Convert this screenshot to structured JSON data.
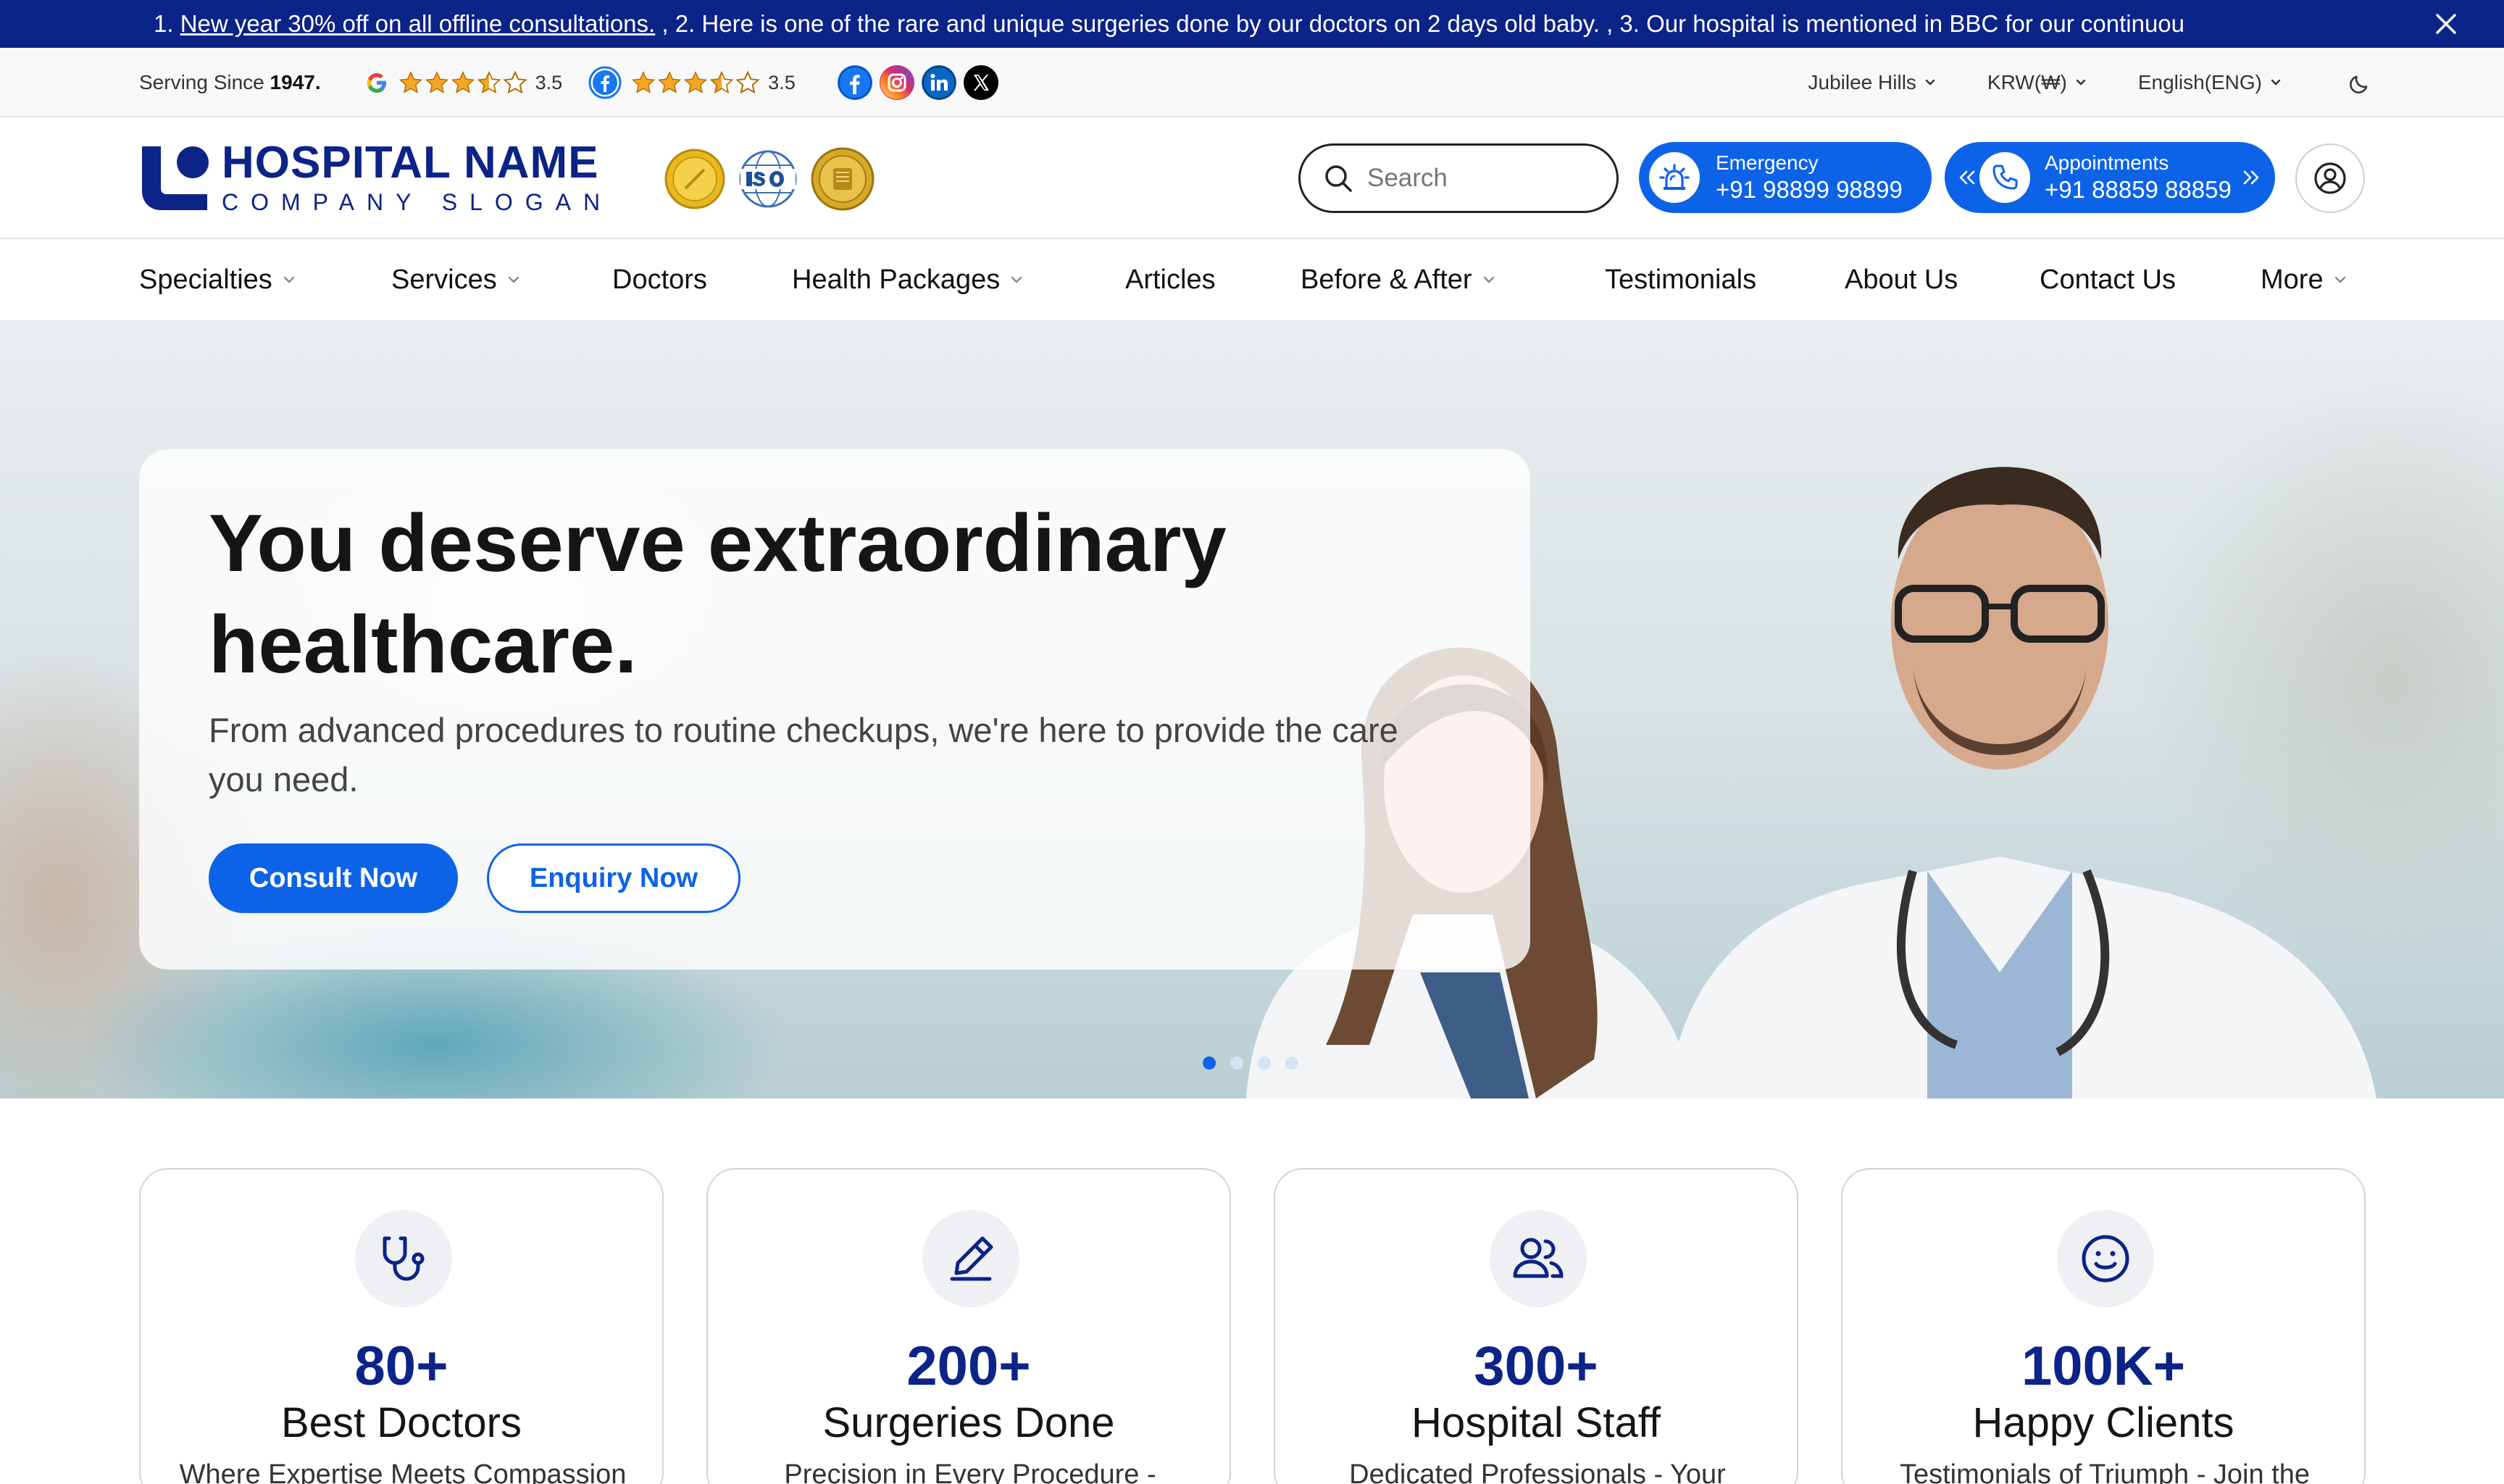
{
  "announcement": {
    "prefix": "1. ",
    "link_text": "New year 30% off on all offline consultations.",
    "rest": " , 2. Here is one of the rare and unique surgeries done by our doctors on 2 days old baby. , 3. Our hospital is mentioned in BBC for our continuou"
  },
  "utility": {
    "serving_label": "Serving Since ",
    "serving_year": "1947.",
    "google_rating": "3.5",
    "facebook_rating": "3.5",
    "location": "Jubilee Hills",
    "currency": "KRW(₩)",
    "language": "English(ENG)"
  },
  "header": {
    "logo_name": "HOSPITAL NAME",
    "logo_slogan": "COMPANY SLOGAN",
    "search_placeholder": "Search",
    "emergency_label": "Emergency",
    "emergency_number": "+91 98899 98899",
    "appointments_label": "Appointments",
    "appointments_number": "+91 88859 88859"
  },
  "nav": {
    "items": [
      {
        "label": "Specialties"
      },
      {
        "label": "Services"
      },
      {
        "label": "Doctors"
      },
      {
        "label": "Health Packages"
      },
      {
        "label": "Articles"
      },
      {
        "label": "Before & After"
      },
      {
        "label": "Testimonials"
      },
      {
        "label": "About Us"
      },
      {
        "label": "Contact Us"
      },
      {
        "label": "More"
      }
    ]
  },
  "hero": {
    "title": "You deserve extraordinary healthcare.",
    "subtitle": "From advanced procedures to routine checkups, we're here to provide the care you need.",
    "primary_cta": "Consult Now",
    "secondary_cta": "Enquiry Now",
    "active_slide": 1,
    "slide_count": 4
  },
  "stats": [
    {
      "value": "80+",
      "label": "Best Doctors",
      "desc": "Where Expertise Meets Compassion",
      "icon": "stethoscope-icon"
    },
    {
      "value": "200+",
      "label": "Surgeries Done",
      "desc": "Precision in Every Procedure -",
      "icon": "scalpel-icon"
    },
    {
      "value": "300+",
      "label": "Hospital Staff",
      "desc": "Dedicated Professionals - Your",
      "icon": "staff-icon"
    },
    {
      "value": "100K+",
      "label": "Happy Clients",
      "desc": "Testimonials of Triumph - Join the",
      "icon": "smile-icon"
    }
  ],
  "colors": {
    "brand_dark": "#0c2387",
    "brand_blue": "#0d63e8",
    "star": "#f5a623"
  }
}
